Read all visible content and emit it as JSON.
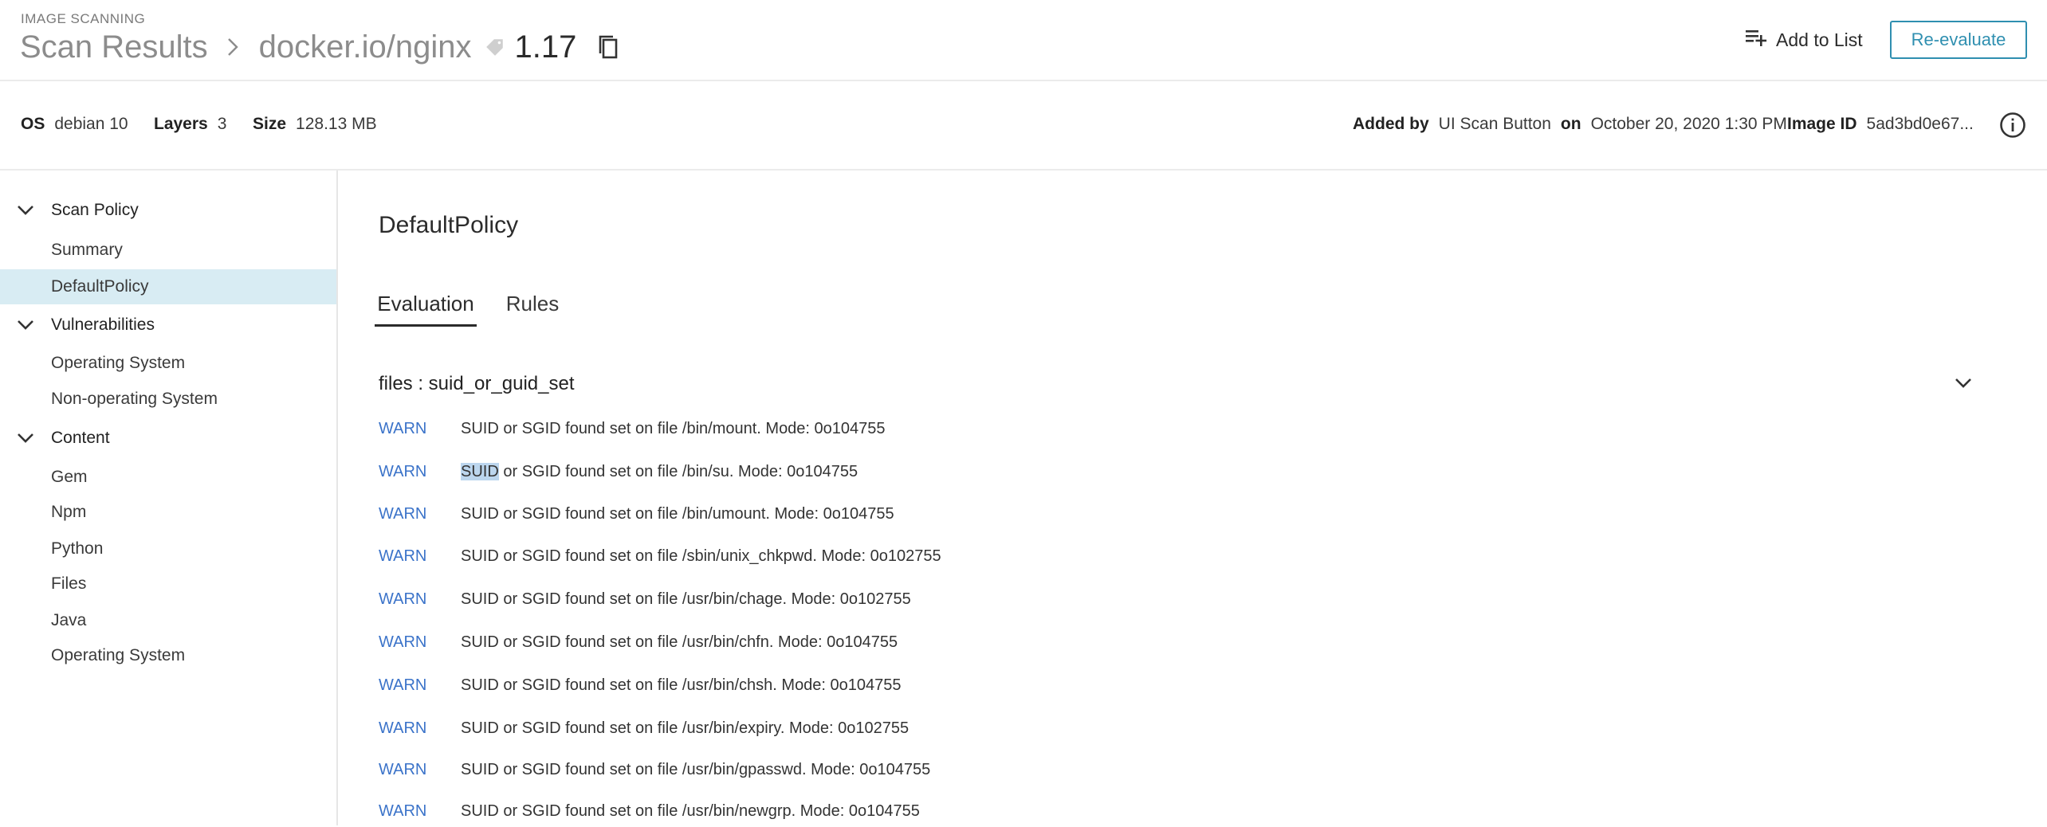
{
  "header": {
    "overline": "IMAGE SCANNING",
    "breadcrumb_root": "Scan Results",
    "repository": "docker.io/nginx",
    "tag": "1.17",
    "add_to_list_label": "Add to List",
    "reevaluate_label": "Re-evaluate"
  },
  "meta": {
    "os_label": "OS",
    "os_value": "debian 10",
    "layers_label": "Layers",
    "layers_value": "3",
    "size_label": "Size",
    "size_value": "128.13 MB",
    "added_by_label": "Added by",
    "added_by_value": "UI Scan Button",
    "on_label": "on",
    "on_value": "October 20, 2020 1:30 PM",
    "image_id_label": "Image ID",
    "image_id_value": "5ad3bd0e67..."
  },
  "sidebar": {
    "sections": [
      {
        "title": "Scan Policy",
        "items": [
          "Summary",
          "DefaultPolicy"
        ]
      },
      {
        "title": "Vulnerabilities",
        "items": [
          "Operating System",
          "Non-operating System"
        ]
      },
      {
        "title": "Content",
        "items": [
          "Gem",
          "Npm",
          "Python",
          "Files",
          "Java",
          "Operating System"
        ]
      }
    ],
    "active_item": "DefaultPolicy"
  },
  "main": {
    "title": "DefaultPolicy",
    "tabs": [
      "Evaluation",
      "Rules"
    ],
    "active_tab": "Evaluation",
    "group_title": "files : suid_or_guid_set",
    "rows": [
      {
        "level": "WARN",
        "message": "SUID or SGID found set on file /bin/mount. Mode: 0o104755"
      },
      {
        "level": "WARN",
        "message_highlight": "SUID",
        "message_rest": " or SGID found set on file /bin/su. Mode: 0o104755"
      },
      {
        "level": "WARN",
        "message": "SUID or SGID found set on file /bin/umount. Mode: 0o104755"
      },
      {
        "level": "WARN",
        "message": "SUID or SGID found set on file /sbin/unix_chkpwd. Mode: 0o102755"
      },
      {
        "level": "WARN",
        "message": "SUID or SGID found set on file /usr/bin/chage. Mode: 0o102755"
      },
      {
        "level": "WARN",
        "message": "SUID or SGID found set on file /usr/bin/chfn. Mode: 0o104755"
      },
      {
        "level": "WARN",
        "message": "SUID or SGID found set on file /usr/bin/chsh. Mode: 0o104755"
      },
      {
        "level": "WARN",
        "message": "SUID or SGID found set on file /usr/bin/expiry. Mode: 0o102755"
      },
      {
        "level": "WARN",
        "message": "SUID or SGID found set on file /usr/bin/gpasswd. Mode: 0o104755"
      },
      {
        "level": "WARN",
        "message": "SUID or SGID found set on file /usr/bin/newgrp. Mode: 0o104755"
      }
    ]
  },
  "colors": {
    "accent": "#2f8fb0",
    "warn_link": "#3b73c9",
    "active_nav_bg": "#d8ecf3",
    "selection_highlight": "#bcd6ee"
  },
  "icons": [
    "chevron-right-icon",
    "tag-icon",
    "copy-icon",
    "playlist-add-icon",
    "info-icon",
    "chevron-down-icon"
  ]
}
